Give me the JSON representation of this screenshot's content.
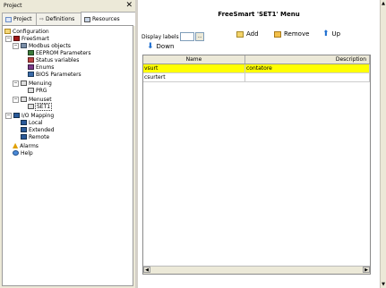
{
  "panel": {
    "title": "Project",
    "close": "✕"
  },
  "tabs": [
    {
      "label": "Project"
    },
    {
      "label": "Definitions"
    },
    {
      "label": "Resources"
    }
  ],
  "tree": [
    {
      "label": "Configuration"
    },
    {
      "label": "FreeSmart"
    },
    {
      "label": "Modbus objects"
    },
    {
      "label": "EEPROM Parameters"
    },
    {
      "label": "Status variables"
    },
    {
      "label": "Enums"
    },
    {
      "label": "BIOS Parameters"
    },
    {
      "label": "Menuing"
    },
    {
      "label": "PRG"
    },
    {
      "label": "Menuset"
    },
    {
      "label": "SET1"
    },
    {
      "label": "I/O Mapping"
    },
    {
      "label": "Local"
    },
    {
      "label": "Extended"
    },
    {
      "label": "Remote"
    },
    {
      "label": "Alarms"
    },
    {
      "label": "Help"
    }
  ],
  "editor": {
    "title": "FreeSmart 'SET1' Menu",
    "display_labels": "Display labels",
    "display_labels_value": "",
    "add": "Add",
    "remove": "Remove",
    "up": "Up",
    "down": "Down"
  },
  "grid": {
    "columns": [
      "Name",
      "Description"
    ],
    "rows": [
      {
        "name": "vsurt",
        "desc": "contatore",
        "selected": true
      },
      {
        "name": "csurtert",
        "desc": "",
        "selected": false
      }
    ]
  },
  "colors": {
    "selection": "#ffff00",
    "accent_blue": "#1f6fd0"
  }
}
